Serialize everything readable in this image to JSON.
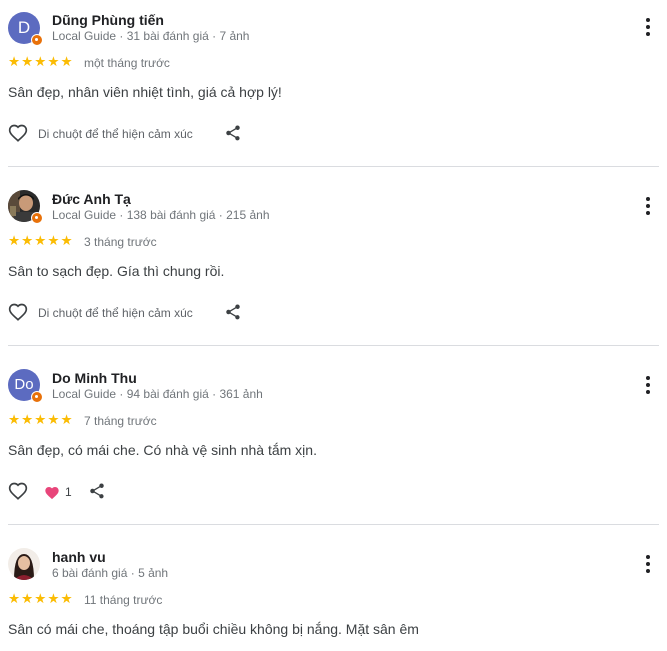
{
  "colors": {
    "star": "#fbbc04",
    "avatar_purple": "#5c6bc0",
    "badge": "#e8710a"
  },
  "icons": {
    "more": "more-vert-icon",
    "heart": "heart-outline-icon",
    "share": "share-icon",
    "star": "star-icon"
  },
  "reviews": [
    {
      "name": "Dũng Phùng tiến",
      "meta": "Local Guide · 31 bài đánh giá · 7 ảnh",
      "avatar_letter": "D",
      "rating": 5,
      "date": "một tháng trước",
      "text": "Sân đẹp, nhân viên nhiệt tình, giá cả hợp lý!",
      "react_label": "Di chuột để thể hiện cảm xúc"
    },
    {
      "name": "Đức Anh Tạ",
      "meta": "Local Guide · 138 bài đánh giá · 215 ảnh",
      "rating": 5,
      "date": "3 tháng trước",
      "text": "Sân to sạch đẹp. Gía thì chung rồi.",
      "react_label": "Di chuột để thể hiện cảm xúc"
    },
    {
      "name": "Do Minh Thu",
      "meta": "Local Guide · 94 bài đánh giá · 361 ảnh",
      "avatar_letter": "Do",
      "rating": 5,
      "date": "7 tháng trước",
      "text": "Sân đẹp, có mái che. Có nhà vệ sinh nhà tắm xịn.",
      "like_count": "1"
    },
    {
      "name": "hanh vu",
      "meta": "6 bài đánh giá · 5 ảnh",
      "rating": 5,
      "date": "11 tháng trước",
      "text": "Sân có mái che, thoáng tập buổi chiều không bị nắng. Mặt sân êm"
    }
  ]
}
